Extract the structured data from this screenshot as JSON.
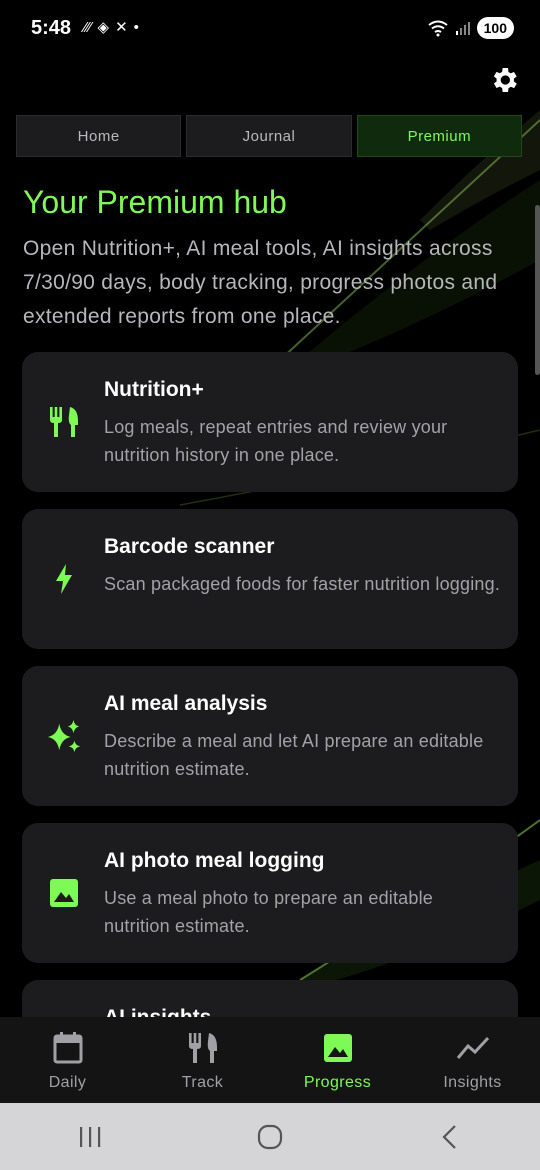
{
  "status_bar": {
    "time": "5:48",
    "battery": "100"
  },
  "tabs": [
    {
      "label": "Home",
      "active": false
    },
    {
      "label": "Journal",
      "active": false
    },
    {
      "label": "Premium",
      "active": true
    }
  ],
  "hub": {
    "title": "Your Premium hub",
    "description": "Open Nutrition+, AI meal tools, AI insights across 7/30/90 days, body tracking, progress photos and extended reports from one place."
  },
  "features": [
    {
      "icon": "fork-knife-icon",
      "title": "Nutrition+",
      "description": "Log meals, repeat entries and review your nutrition history in one place."
    },
    {
      "icon": "lightning-icon",
      "title": "Barcode scanner",
      "description": "Scan packaged foods for faster nutrition logging."
    },
    {
      "icon": "sparkles-icon",
      "title": "AI meal analysis",
      "description": "Describe a meal and let AI prepare an editable nutrition estimate."
    },
    {
      "icon": "image-icon",
      "title": "AI photo meal logging",
      "description": "Use a meal photo to prepare an editable nutrition estimate."
    },
    {
      "icon": "insights-icon",
      "title": "AI insights",
      "description": ""
    }
  ],
  "bottom_nav": [
    {
      "label": "Daily",
      "icon": "calendar-icon",
      "active": false
    },
    {
      "label": "Track",
      "icon": "fork-knife-icon",
      "active": false
    },
    {
      "label": "Progress",
      "icon": "image-icon",
      "active": true
    },
    {
      "label": "Insights",
      "icon": "trend-icon",
      "active": false
    }
  ],
  "colors": {
    "accent": "#7dfa56",
    "card": "#1c1c1e",
    "background": "#000000"
  }
}
